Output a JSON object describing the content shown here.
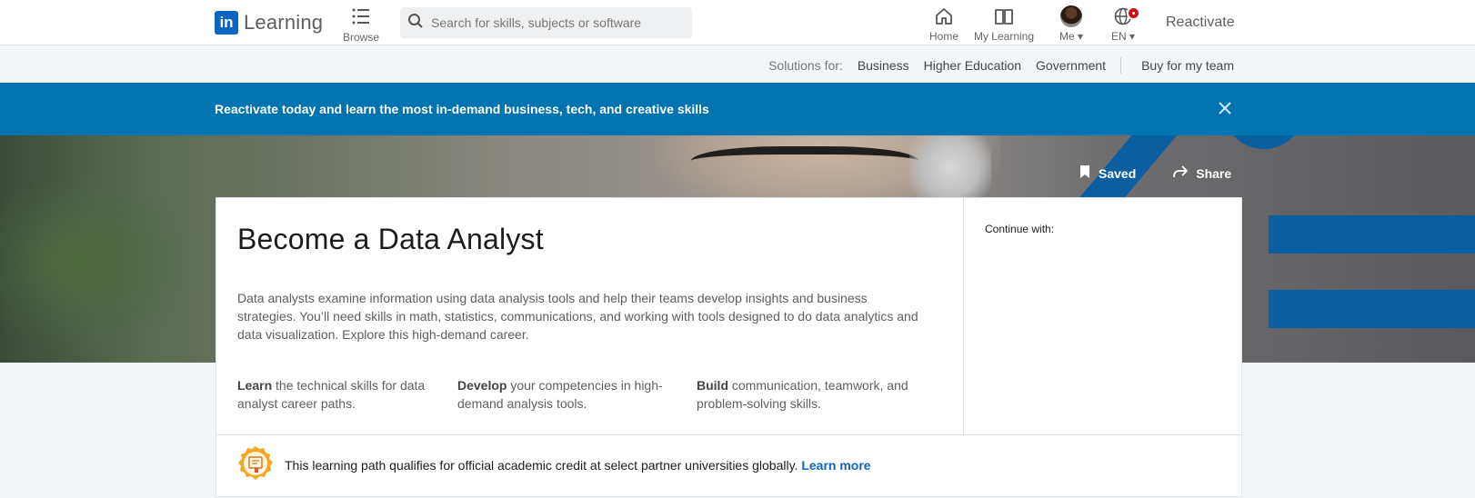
{
  "topnav": {
    "logo_mark": "in",
    "logo_text": "Learning",
    "browse_label": "Browse",
    "search_placeholder": "Search for skills, subjects or software",
    "items": [
      {
        "label": "Home",
        "icon": "home-icon"
      },
      {
        "label": "My Learning",
        "icon": "book-icon"
      },
      {
        "label": "Me",
        "icon": "avatar"
      },
      {
        "label": "EN",
        "icon": "globe-icon"
      }
    ],
    "reactivate_label": "Reactivate"
  },
  "solutions": {
    "label": "Solutions for:",
    "links": [
      "Business",
      "Higher Education",
      "Government"
    ],
    "buy_label": "Buy for my team"
  },
  "banner": {
    "text": "Reactivate today and learn the most in-demand business, tech, and creative skills",
    "close_icon": "close-icon"
  },
  "hero": {
    "saved_label": "Saved",
    "share_label": "Share"
  },
  "card": {
    "title": "Become a Data Analyst",
    "description": "Data analysts examine information using data analysis tools and help their teams develop insights and business strategies. You’ll need skills in math, statistics, communications, and working with tools designed to do data analytics and data visualization. Explore this high-demand career.",
    "bullets": [
      {
        "bold": "Learn",
        "text": " the technical skills for data analyst career paths."
      },
      {
        "bold": "Develop",
        "text": " your competencies in high-demand analysis tools."
      },
      {
        "bold": "Build",
        "text": " communication, teamwork, and problem-solving skills."
      }
    ],
    "continue_label": "Continue with:",
    "credit_text": "This learning path qualifies for official academic credit at select partner universities globally.",
    "credit_link": "Learn more"
  },
  "colors": {
    "accent": "#0a66c2",
    "banner": "#0073b1",
    "notification": "#cc1016"
  }
}
